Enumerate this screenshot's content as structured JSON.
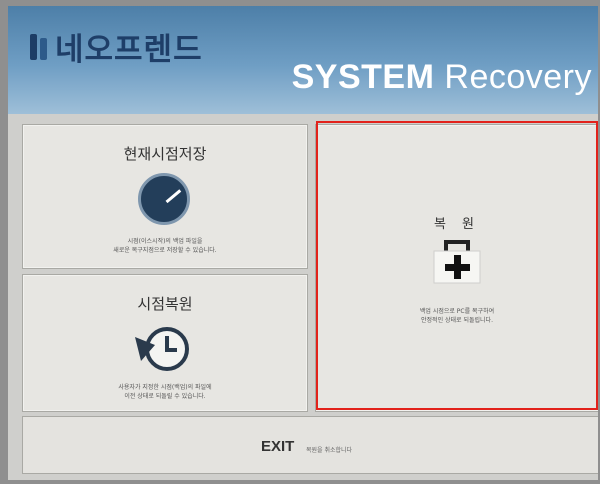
{
  "header": {
    "brand": "네오프렌드",
    "title_bold": "SYSTEM",
    "title_rest": "Recovery",
    "brand_color": "#1e3e68"
  },
  "panels": {
    "save": {
      "title": "현재시점저장",
      "icon": "gauge-icon",
      "desc_line1": "시점(이스시작)의 백업 파일을",
      "desc_line2": "새로운 복구지점으로 저장할 수 있습니다."
    },
    "rollback": {
      "title": "시점복원",
      "icon": "clock-rollback-icon",
      "desc_line1": "사용자가 지정한 시점(백업)의 파일에",
      "desc_line2": "이전 상태로 되돌릴 수 있습니다."
    },
    "recover": {
      "title": "복 원",
      "icon": "first-aid-kit-icon",
      "desc_line1": "백업 시점으로 PC를 복구하여",
      "desc_line2": "안정적인 상태로 되돌립니다."
    }
  },
  "exit": {
    "label": "EXIT",
    "hint": "복원을 취소합니다"
  },
  "highlight_color": "#e2221b"
}
